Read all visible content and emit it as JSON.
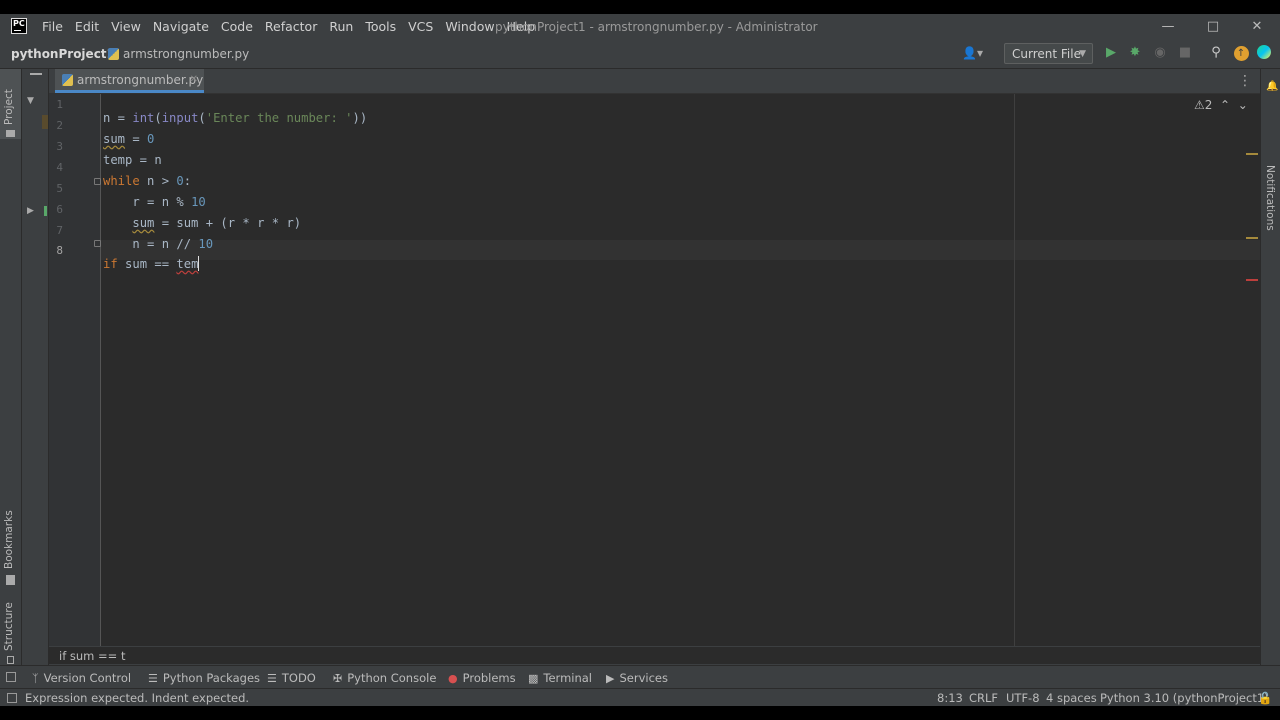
{
  "menu": [
    "File",
    "Edit",
    "View",
    "Navigate",
    "Code",
    "Refactor",
    "Run",
    "Tools",
    "VCS",
    "Window",
    "Help"
  ],
  "window_title": "pythonProject1 - armstrongnumber.py - Administrator",
  "logo_text": "PC",
  "nav": {
    "project": "pythonProject1",
    "file": "armstrongnumber.py"
  },
  "run_config": "Current File",
  "editor_tab": "armstrongnumber.py",
  "inspection": {
    "warning_count": "2"
  },
  "code": {
    "line_numbers": [
      "1",
      "2",
      "3",
      "4",
      "5",
      "6",
      "7",
      "8"
    ],
    "l1_a": "n = ",
    "l1_int": "int",
    "l1_b": "(",
    "l1_input": "input",
    "l1_c": "(",
    "l1_str": "'Enter the number: '",
    "l1_d": "))",
    "l2_sum": "sum",
    "l2_b": " = ",
    "l2_num": "0",
    "l3": "temp = n",
    "l4_kw": "while",
    "l4_b": " n > ",
    "l4_num": "0",
    "l4_c": ":",
    "l5_a": "    r = n % ",
    "l5_num": "10",
    "l6_ind": "    ",
    "l6_sum": "sum",
    "l6_rest": " = sum + (r * r * r)",
    "l7_a": "    n = n // ",
    "l7_num": "10",
    "l8_kw": "if",
    "l8_b": " sum == ",
    "l8_c": "tem"
  },
  "breadcrumb": "if sum == t",
  "left_tools": {
    "project": "Project",
    "bookmarks": "Bookmarks",
    "structure": "Structure"
  },
  "right_tools": {
    "notifications": "Notifications"
  },
  "tool_windows": [
    "Version Control",
    "Python Packages",
    "TODO",
    "Python Console",
    "Problems",
    "Terminal",
    "Services"
  ],
  "status": {
    "message": "Expression expected. Indent expected.",
    "position": "8:13",
    "line_sep": "CRLF",
    "encoding": "UTF-8",
    "indent": "4 spaces",
    "interpreter": "Python 3.10 (pythonProject1)"
  },
  "colors": {
    "keyword": "#cc7832",
    "number": "#6897bb",
    "string": "#6a8759",
    "builtin": "#8888c6",
    "run": "#59a869",
    "accent": "#4a88c7"
  }
}
